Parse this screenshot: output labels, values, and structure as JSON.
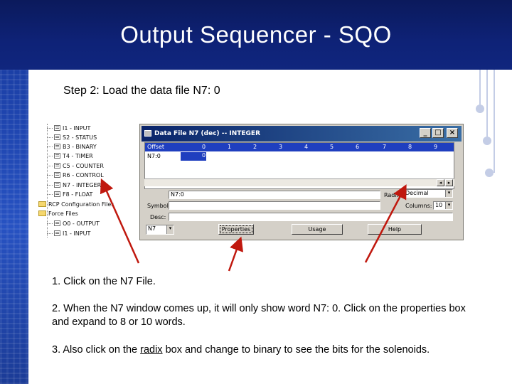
{
  "slide": {
    "title": "Output Sequencer - SQO",
    "step_heading": "Step 2:  Load the data file N7: 0"
  },
  "tree": {
    "items": [
      {
        "label": "I1 - INPUT",
        "icon": "file-icon"
      },
      {
        "label": "S2 - STATUS",
        "icon": "file-icon"
      },
      {
        "label": "B3 - BINARY",
        "icon": "file-icon"
      },
      {
        "label": "T4 - TIMER",
        "icon": "file-icon"
      },
      {
        "label": "C5 - COUNTER",
        "icon": "file-icon"
      },
      {
        "label": "R6 - CONTROL",
        "icon": "file-icon"
      },
      {
        "label": "N7 - INTEGER",
        "icon": "file-icon"
      },
      {
        "label": "F8 - FLOAT",
        "icon": "file-icon"
      },
      {
        "label": "RCP Configuration Files",
        "icon": "folder-icon"
      },
      {
        "label": "Force Files",
        "icon": "folder-icon"
      },
      {
        "label": "O0 - OUTPUT",
        "icon": "file-icon"
      },
      {
        "label": "I1 - INPUT",
        "icon": "file-icon"
      }
    ]
  },
  "data_window": {
    "title": "Data File N7 (dec) -- INTEGER",
    "buttons": {
      "minimize": "_",
      "maximize": "□",
      "close": "×"
    },
    "columns": [
      "Offset",
      "0",
      "1",
      "2",
      "3",
      "4",
      "5",
      "6",
      "7",
      "8",
      "9"
    ],
    "rows": [
      {
        "offset": "N7:0",
        "values": [
          "0"
        ]
      }
    ],
    "address_value": "N7:0",
    "radix_label": "Radix:",
    "radix_value": "Decimal",
    "symbol_label": "Symbol:",
    "columns_label": "Columns:",
    "columns_value": "10",
    "desc_label": "Desc:",
    "file_select_value": "N7",
    "properties_button": "Properties",
    "usage_button": "Usage",
    "help_button": "Help"
  },
  "instructions": {
    "item1": "1.  Click on the N7 File.",
    "item2": "2.  When the N7 window comes up, it will only show word N7: 0.  Click on the properties box and expand to 8 or 10 words.",
    "item3_before": "3.  Also click on the ",
    "item3_link": "radix",
    "item3_after": " box and change to binary to see the bits  for the solenoids."
  },
  "colors": {
    "header_bg": "#0e2277",
    "arrow": "#c0180e",
    "accent_dot": "#c4cde6"
  }
}
